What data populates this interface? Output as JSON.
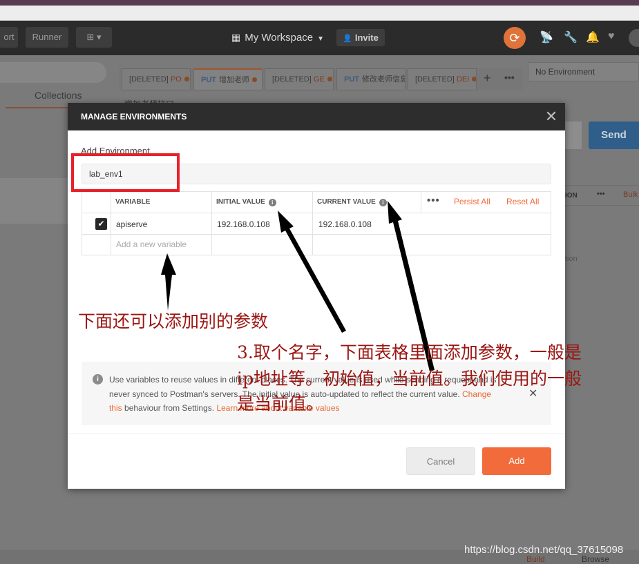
{
  "toolbar": {
    "import_partial": "ort",
    "runner": "Runner",
    "workspace": "My Workspace",
    "invite": "Invite"
  },
  "sidebar": {
    "tab": "Collections"
  },
  "tabs": [
    {
      "method": "",
      "label": "[DELETED]",
      "suffix": "PO"
    },
    {
      "method": "PUT",
      "label": "增加老师",
      "suffix": ""
    },
    {
      "method": "",
      "label": "[DELETED]",
      "suffix": "GE"
    },
    {
      "method": "PUT",
      "label": "修改老师信息",
      "suffix": ""
    },
    {
      "method": "",
      "label": "[DELETED]",
      "suffix": "DEI"
    }
  ],
  "request_title_partial": "增加老师接口",
  "environment_selector": "No Environment",
  "send": "Send",
  "background_partial": {
    "params_col": "ION",
    "bulk": "Bulk",
    "desc": "tion",
    "build": "Build",
    "browse": "Browse"
  },
  "modal": {
    "title": "MANAGE ENVIRONMENTS",
    "close_icon": "close-icon",
    "add_label": "Add Environment",
    "env_name": "lab_env1",
    "columns": {
      "variable": "VARIABLE",
      "initial": "INITIAL VALUE",
      "current": "CURRENT VALUE"
    },
    "persist_all": "Persist All",
    "reset_all": "Reset All",
    "rows": [
      {
        "checked": true,
        "variable": "apiserve",
        "initial": "192.168.0.108",
        "current": "192.168.0.108"
      }
    ],
    "new_variable_placeholder": "Add a new variable",
    "notice": {
      "line1": "Use variables to reuse values in different places. The current value is used while sending a request and is",
      "line2": "never synced to Postman's servers. The initial value is auto-updated to reflect the current value.",
      "link_change": "Change",
      "link_this": "this",
      "line3_mid": " behaviour from Settings. ",
      "link_learn": "Learn more about variable values"
    },
    "cancel": "Cancel",
    "add": "Add"
  },
  "annotations": {
    "note1": "下面还可以添加别的参数",
    "note2_l1": "3.取个名字，下面表格里面添加参数，一般是",
    "note2_l2": "ip地址等。初始值，当前值。我们使用的一般",
    "note2_l3": "是当前值。"
  },
  "watermark": "https://blog.csdn.net/qq_37615098",
  "colors": {
    "accent": "#f26b3a",
    "annotation": "#9b1612",
    "highlight_box": "#e8202a"
  }
}
